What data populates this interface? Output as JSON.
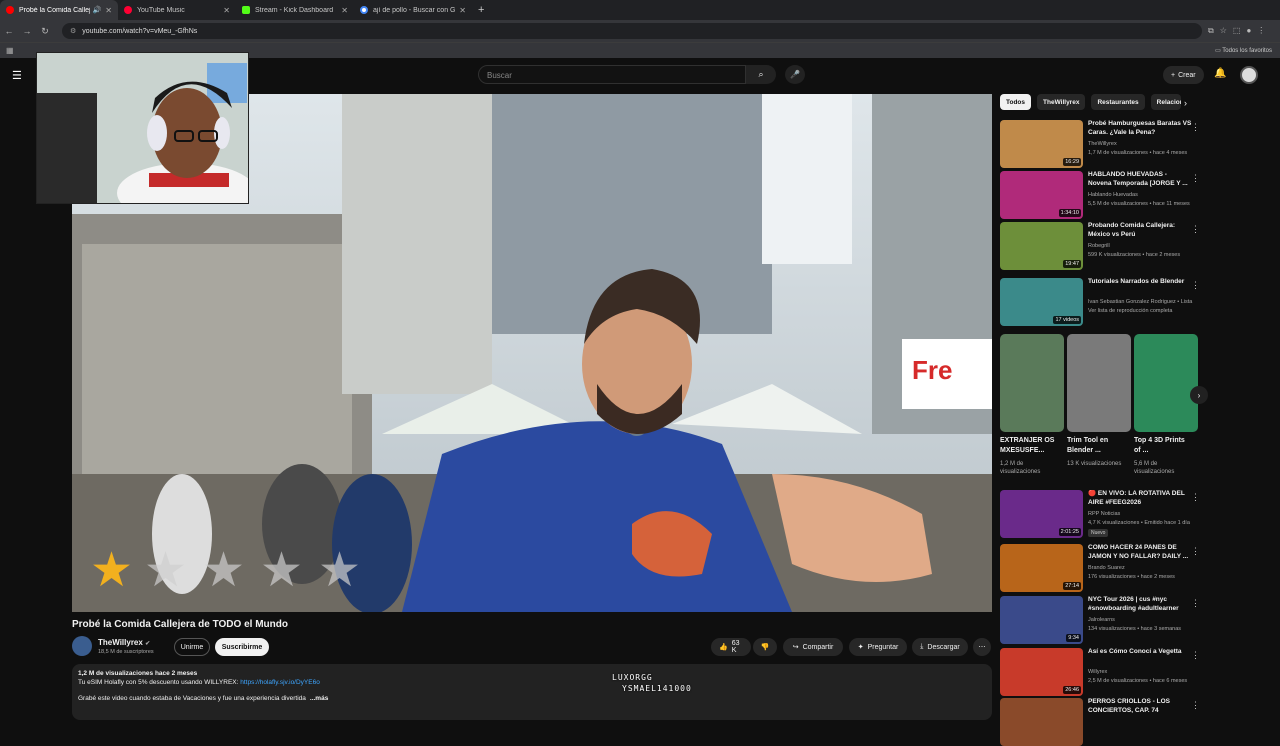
{
  "browser": {
    "tabs": [
      {
        "label": "Probé la Comida Callejera d",
        "color": "#ff0000"
      },
      {
        "label": "YouTube Music",
        "color": "#ff0033"
      },
      {
        "label": "Stream - Kick Dashboard",
        "color": "#53fc18"
      },
      {
        "label": "ají de pollo - Buscar con Google",
        "color": "#4285f4"
      }
    ],
    "url": "youtube.com/watch?v=vMeu_-GfhNs",
    "bookmarks_folder": "Todos los favoritos"
  },
  "header": {
    "search_placeholder": "Buscar",
    "create_label": "Crear"
  },
  "video": {
    "title": "Probé la Comida Callejera de TODO el Mundo",
    "channel": "TheWillyrex",
    "subscribers": "18,5 M de suscriptores",
    "join_label": "Unirme",
    "subscribe_label": "Suscribirme",
    "likes": "63 K",
    "share_label": "Compartir",
    "ask_label": "Preguntar",
    "download_label": "Descargar",
    "description_meta": "1,2 M de visualizaciones  hace 2 meses",
    "description_line1": "Tu eSIM Holafly con 5% descuento usando WILLYREX: ",
    "description_link": "https://holafly.sjv.io/DyYE6o",
    "description_line2": "Grabé este video cuando estaba de Vacaciones y fue una experiencia divertida",
    "more_label": "...más",
    "overlay_names": [
      "LUXORGG",
      "YSMAEL141000"
    ]
  },
  "sidebar": {
    "chips": [
      "Todos",
      "TheWillyrex",
      "Restaurantes",
      "Relaciona"
    ],
    "recommendations_top": [
      {
        "title": "Probé Hamburguesas Baratas VS Caras. ¿Vale la Pena?",
        "channel": "TheWillyrex",
        "meta": "1,7 M de visualizaciones • hace 4 meses",
        "duration": "16:29",
        "color": "#c08a4a"
      },
      {
        "title": "HABLANDO HUEVADAS - Novena Temporada [JORGE Y ...",
        "channel": "Hablando Huevadas",
        "meta": "5,5 M de visualizaciones • hace 11 meses",
        "duration": "1:34:10",
        "color": "#b02a7a"
      },
      {
        "title": "Probando Comida Callejera: México vs Perú",
        "channel": "Robegrill",
        "meta": "599 K visualizaciones • hace 2 meses",
        "duration": "19:47",
        "color": "#6d8f3a"
      },
      {
        "title": "Tutoriales Narrados de Blender",
        "channel": "Ivan Sebastian Gonzalez Rodriguez • Lista",
        "meta": "Ver lista de reproducción completa",
        "duration": "17 videos",
        "color": "#3b8a8a"
      }
    ],
    "shorts": [
      {
        "title": "EXTRANJER OS MXESUSFE...",
        "views": "1,2 M de visualizaciones",
        "color": "#5a7a5a"
      },
      {
        "title": "Trim Tool en Blender ...",
        "views": "13 K visualizaciones",
        "color": "#7a7a7a"
      },
      {
        "title": "Top 4 3D Prints of ...",
        "views": "5,6 M de visualizaciones",
        "color": "#2c8a5a"
      }
    ],
    "recommendations_bottom": [
      {
        "title": "🔴 EN VIVO: LA ROTATIVA DEL AIRE #FEEG2026",
        "channel": "RPP Noticias",
        "meta": "4,7 K visualizaciones • Emitido hace 1 día",
        "duration": "2:01:25",
        "badge": "Nuevo",
        "color": "#6a2a8a"
      },
      {
        "title": "COMO HACER 24 PANES DE JAMON Y NO FALLAR? DAILY ...",
        "channel": "Brando Suarez",
        "meta": "176 visualizaciones • hace 2 meses",
        "duration": "27:14",
        "color": "#b8651a"
      },
      {
        "title": "NYC Tour 2026 | cus #nyc #snowboarding #adultlearner",
        "channel": "Jalrolearns",
        "meta": "134 visualizaciones • hace 3 semanas",
        "duration": "9:34",
        "color": "#3a4a8a"
      },
      {
        "title": "Así es Cómo Conocí a Vegetta",
        "channel": "Willyrex",
        "meta": "2,5 M de visualizaciones • hace 6 meses",
        "duration": "26:46",
        "color": "#c83a2a"
      },
      {
        "title": "PERROS CRIOLLOS - LOS CONCIERTOS, CAP. 74",
        "channel": "",
        "meta": "",
        "duration": "",
        "color": "#8a4a2a"
      }
    ]
  }
}
